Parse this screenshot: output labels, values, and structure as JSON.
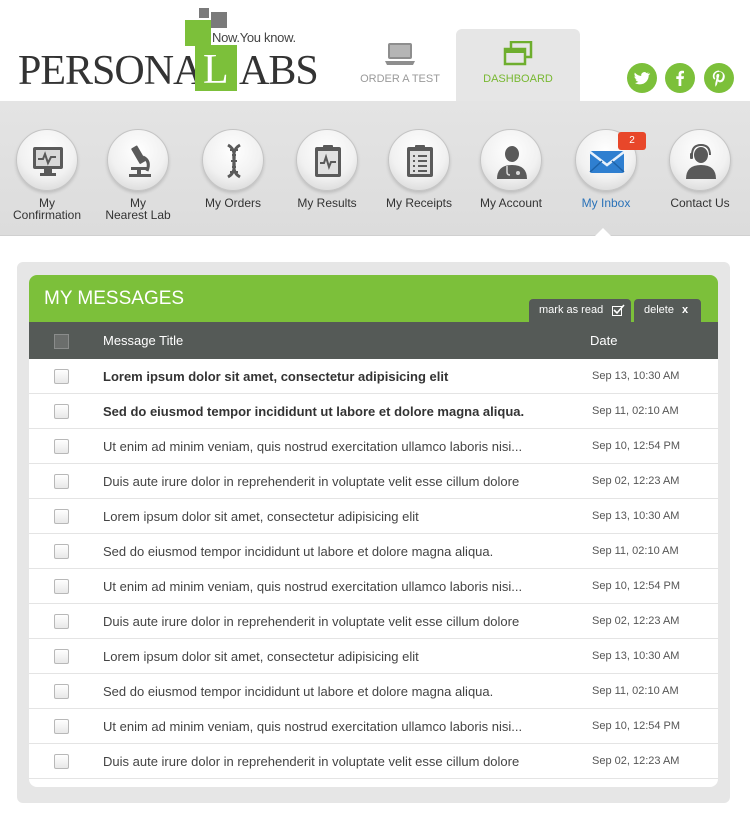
{
  "brand": {
    "tagline": "Now.You know.",
    "name_part1": "PERSONA",
    "name_box_letter": "L",
    "name_part2": "ABS",
    "accent_color": "#7cc03a"
  },
  "top_tabs": [
    {
      "label": "ORDER A TEST",
      "icon": "laptop-icon",
      "active": false
    },
    {
      "label": "DASHBOARD",
      "icon": "windows-icon",
      "active": true
    }
  ],
  "social": [
    {
      "name": "twitter-icon",
      "glyph": "t"
    },
    {
      "name": "facebook-icon",
      "glyph": "f"
    },
    {
      "name": "pinterest-icon",
      "glyph": "p"
    }
  ],
  "nav": {
    "items": [
      {
        "label": "My\nConfirmation",
        "icon": "monitor-icon"
      },
      {
        "label": "My\nNearest Lab",
        "icon": "microscope-icon"
      },
      {
        "label": "My Orders",
        "icon": "dna-icon"
      },
      {
        "label": "My Results",
        "icon": "clipboard-chart-icon"
      },
      {
        "label": "My Receipts",
        "icon": "checklist-icon"
      },
      {
        "label": "My Account",
        "icon": "doctor-icon"
      },
      {
        "label": "My Inbox",
        "icon": "envelope-icon",
        "badge": "2",
        "active": true
      },
      {
        "label": "Contact Us",
        "icon": "support-agent-icon"
      }
    ]
  },
  "messages": {
    "title": "MY MESSAGES",
    "mark_as_read": "mark as read",
    "delete": "delete",
    "delete_x": "x",
    "col_title": "Message Title",
    "col_date": "Date",
    "rows": [
      {
        "title": "Lorem ipsum dolor sit amet, consectetur adipisicing elit",
        "date": "Sep 13, 10:30 AM",
        "unread": true
      },
      {
        "title": "Sed do eiusmod tempor incididunt ut labore et dolore magna aliqua.",
        "date": "Sep 11, 02:10 AM",
        "unread": true
      },
      {
        "title": "Ut enim ad minim veniam, quis nostrud exercitation ullamco laboris nisi...",
        "date": "Sep 10, 12:54 PM",
        "unread": false
      },
      {
        "title": "Duis aute irure dolor in reprehenderit in voluptate velit esse cillum dolore",
        "date": "Sep 02, 12:23 AM",
        "unread": false
      },
      {
        "title": "Lorem ipsum dolor sit amet, consectetur adipisicing elit",
        "date": "Sep 13, 10:30 AM",
        "unread": false
      },
      {
        "title": "Sed do eiusmod tempor incididunt ut labore et dolore magna aliqua.",
        "date": "Sep 11, 02:10 AM",
        "unread": false
      },
      {
        "title": "Ut enim ad minim veniam, quis nostrud exercitation ullamco laboris nisi...",
        "date": "Sep 10, 12:54 PM",
        "unread": false
      },
      {
        "title": "Duis aute irure dolor in reprehenderit in voluptate velit esse cillum dolore",
        "date": "Sep 02, 12:23 AM",
        "unread": false
      },
      {
        "title": "Lorem ipsum dolor sit amet, consectetur adipisicing elit",
        "date": "Sep 13, 10:30 AM",
        "unread": false
      },
      {
        "title": "Sed do eiusmod tempor incididunt ut labore et dolore magna aliqua.",
        "date": "Sep 11, 02:10 AM",
        "unread": false
      },
      {
        "title": "Ut enim ad minim veniam, quis nostrud exercitation ullamco laboris nisi...",
        "date": "Sep 10, 12:54 PM",
        "unread": false
      },
      {
        "title": "Duis aute irure dolor in reprehenderit in voluptate velit esse cillum dolore",
        "date": "Sep 02, 12:23 AM",
        "unread": false
      }
    ]
  }
}
